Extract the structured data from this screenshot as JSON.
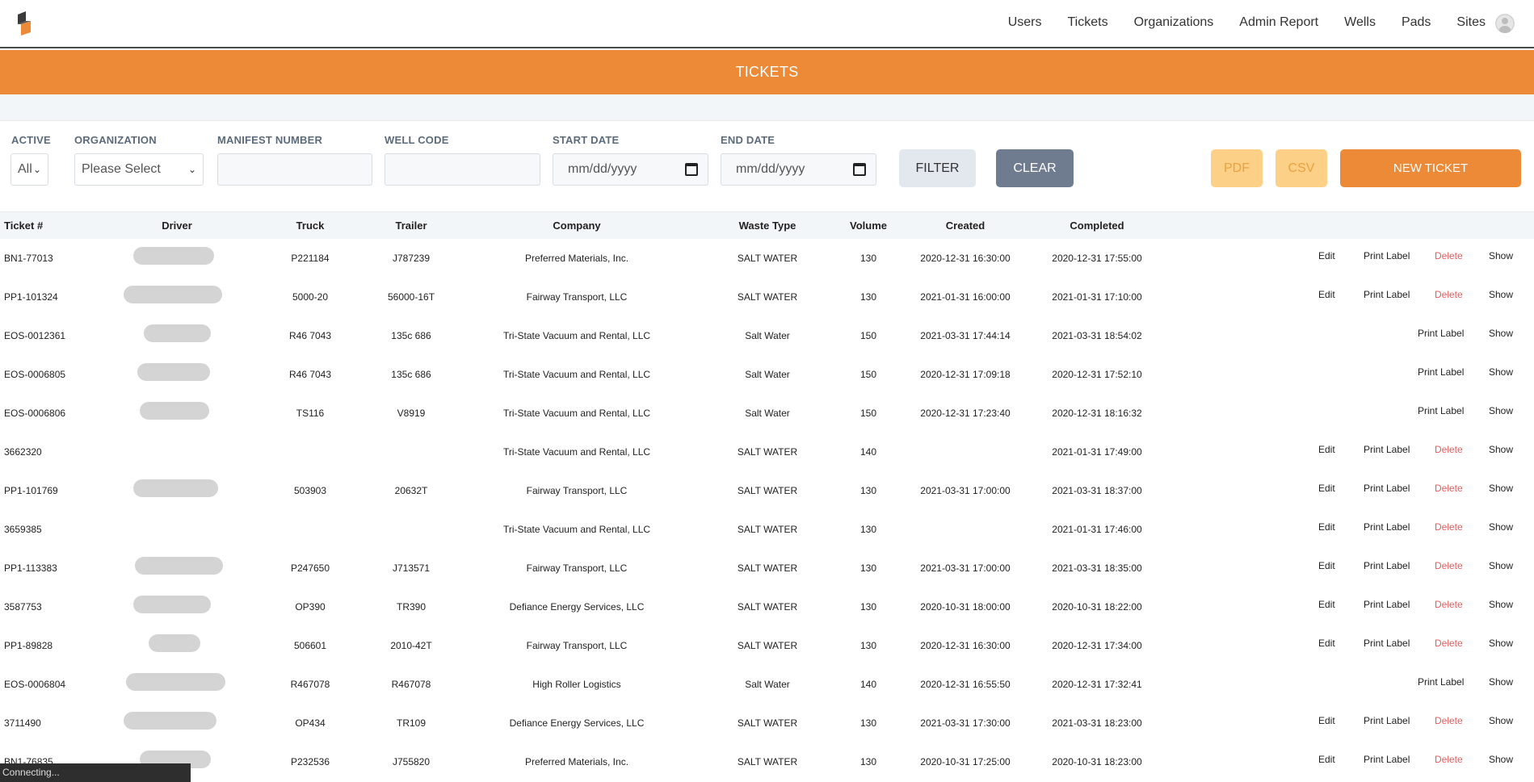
{
  "nav": {
    "links": [
      "Users",
      "Tickets",
      "Organizations",
      "Admin Report",
      "Wells",
      "Pads",
      "Sites"
    ]
  },
  "banner": {
    "title": "TICKETS"
  },
  "filters": {
    "active_label": "ACTIVE",
    "active_value": "All",
    "organization_label": "ORGANIZATION",
    "organization_value": "Please Select",
    "manifest_label": "MANIFEST NUMBER",
    "well_label": "WELL CODE",
    "start_label": "START DATE",
    "start_placeholder": "mm/dd/yyyy",
    "end_label": "END DATE",
    "end_placeholder": "mm/dd/yyyy",
    "filter_button": "FILTER",
    "clear_button": "CLEAR",
    "pdf_button": "PDF",
    "csv_button": "CSV",
    "new_ticket_button": "NEW TICKET"
  },
  "table": {
    "headers": [
      "Ticket #",
      "Driver",
      "Truck",
      "Trailer",
      "Company",
      "Waste Type",
      "Volume",
      "Created",
      "Completed"
    ],
    "action_labels": {
      "edit": "Edit",
      "print": "Print Label",
      "delete": "Delete",
      "show": "Show"
    },
    "rows": [
      {
        "ticket": "BN1-77013",
        "truck": "P221184",
        "trailer": "J787239",
        "company": "Preferred Materials, Inc.",
        "waste": "SALT WATER",
        "volume": "130",
        "created": "2020-12-31 16:30:00",
        "completed": "2020-12-31 17:55:00",
        "full": true
      },
      {
        "ticket": "PP1-101324",
        "truck": "5000-20",
        "trailer": "56000-16T",
        "company": "Fairway Transport, LLC",
        "waste": "SALT WATER",
        "volume": "130",
        "created": "2021-01-31 16:00:00",
        "completed": "2021-01-31 17:10:00",
        "full": true
      },
      {
        "ticket": "EOS-0012361",
        "truck": "R46 7043",
        "trailer": "135c 686",
        "company": "Tri-State Vacuum and Rental, LLC",
        "waste": "Salt Water",
        "volume": "150",
        "created": "2021-03-31 17:44:14",
        "completed": "2021-03-31 18:54:02",
        "full": false
      },
      {
        "ticket": "EOS-0006805",
        "truck": "R46 7043",
        "trailer": "135c 686",
        "company": "Tri-State Vacuum and Rental, LLC",
        "waste": "Salt Water",
        "volume": "150",
        "created": "2020-12-31 17:09:18",
        "completed": "2020-12-31 17:52:10",
        "full": false
      },
      {
        "ticket": "EOS-0006806",
        "truck": "TS116",
        "trailer": "V8919",
        "company": "Tri-State Vacuum and Rental, LLC",
        "waste": "Salt Water",
        "volume": "150",
        "created": "2020-12-31 17:23:40",
        "completed": "2020-12-31 18:16:32",
        "full": false
      },
      {
        "ticket": "3662320",
        "truck": "",
        "trailer": "",
        "company": "Tri-State Vacuum and Rental, LLC",
        "waste": "SALT WATER",
        "volume": "140",
        "created": "",
        "completed": "2021-01-31 17:49:00",
        "full": true
      },
      {
        "ticket": "PP1-101769",
        "truck": "503903",
        "trailer": "20632T",
        "company": "Fairway Transport, LLC",
        "waste": "SALT WATER",
        "volume": "130",
        "created": "2021-03-31 17:00:00",
        "completed": "2021-03-31 18:37:00",
        "full": true
      },
      {
        "ticket": "3659385",
        "truck": "",
        "trailer": "",
        "company": "Tri-State Vacuum and Rental, LLC",
        "waste": "SALT WATER",
        "volume": "130",
        "created": "",
        "completed": "2021-01-31 17:46:00",
        "full": true
      },
      {
        "ticket": "PP1-113383",
        "truck": "P247650",
        "trailer": "J713571",
        "company": "Fairway Transport, LLC",
        "waste": "SALT WATER",
        "volume": "130",
        "created": "2021-03-31 17:00:00",
        "completed": "2021-03-31 18:35:00",
        "full": true
      },
      {
        "ticket": "3587753",
        "truck": "OP390",
        "trailer": "TR390",
        "company": "Defiance Energy Services, LLC",
        "waste": "SALT WATER",
        "volume": "130",
        "created": "2020-10-31 18:00:00",
        "completed": "2020-10-31 18:22:00",
        "full": true
      },
      {
        "ticket": "PP1-89828",
        "truck": "506601",
        "trailer": "2010-42T",
        "company": "Fairway Transport, LLC",
        "waste": "SALT WATER",
        "volume": "130",
        "created": "2020-12-31 16:30:00",
        "completed": "2020-12-31 17:34:00",
        "full": true
      },
      {
        "ticket": "EOS-0006804",
        "truck": "R467078",
        "trailer": "R467078",
        "company": "High Roller Logistics",
        "waste": "Salt Water",
        "volume": "140",
        "created": "2020-12-31 16:55:50",
        "completed": "2020-12-31 17:32:41",
        "full": false
      },
      {
        "ticket": "3711490",
        "truck": "OP434",
        "trailer": "TR109",
        "company": "Defiance Energy Services, LLC",
        "waste": "SALT WATER",
        "volume": "130",
        "created": "2021-03-31 17:30:00",
        "completed": "2021-03-31 18:23:00",
        "full": true
      },
      {
        "ticket": "BN1-76835",
        "truck": "P232536",
        "trailer": "J755820",
        "company": "Preferred Materials, Inc.",
        "waste": "SALT WATER",
        "volume": "130",
        "created": "2020-10-31 17:25:00",
        "completed": "2020-10-31 18:23:00",
        "full": true
      }
    ]
  },
  "status_bar": {
    "text": "Connecting..."
  }
}
